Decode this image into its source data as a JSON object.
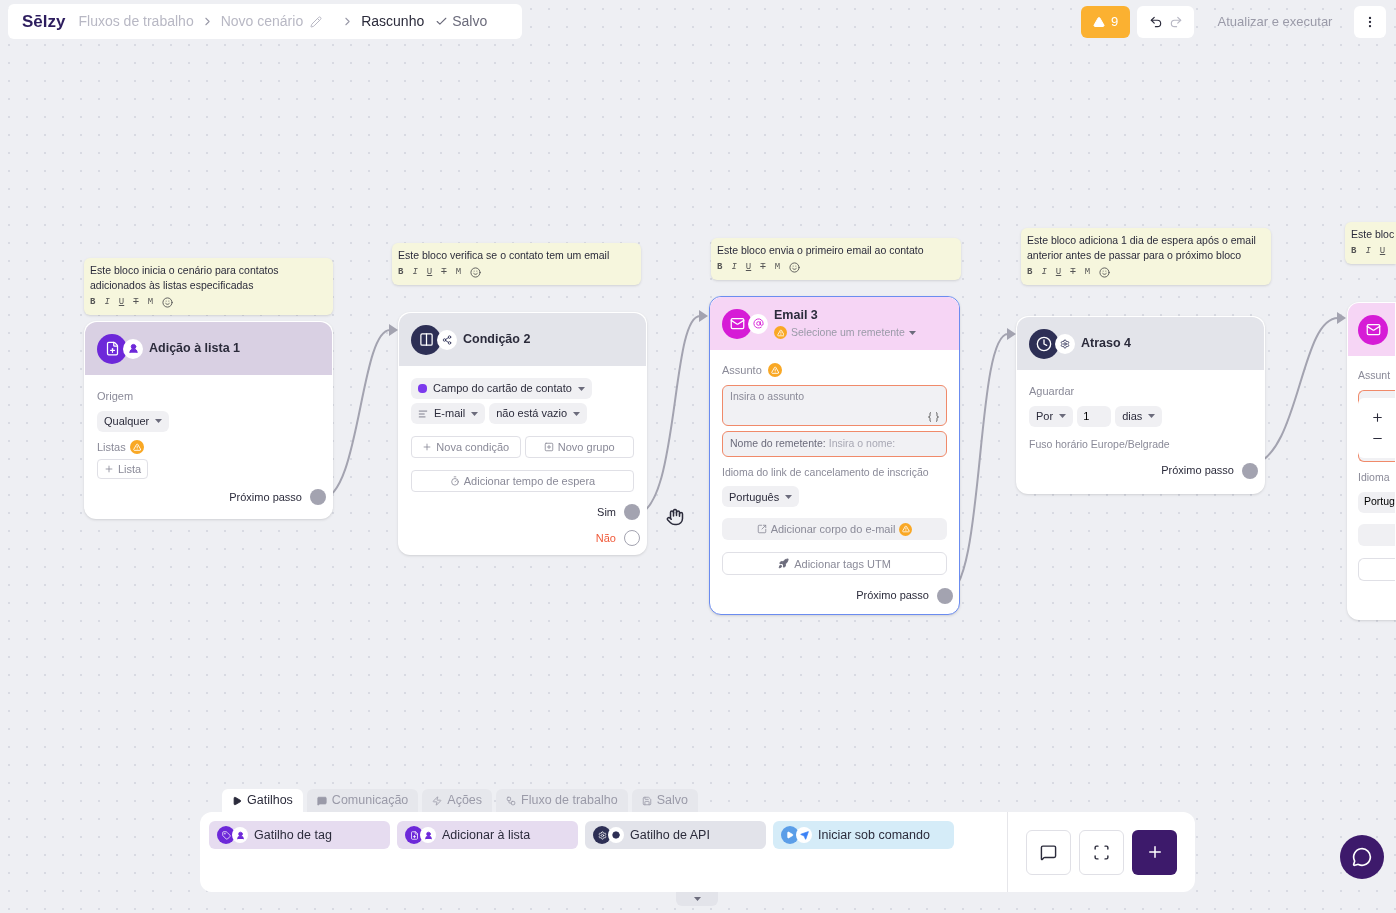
{
  "header": {
    "logo": "Sēlzy",
    "breadcrumbs": [
      "Fluxos de trabalho",
      "Novo cenário"
    ],
    "status": "Rascunho",
    "saved": "Salvo"
  },
  "toolbar": {
    "warnings": "9",
    "run": "Atualizar e executar"
  },
  "notes": [
    {
      "text": "Este bloco inicia o cenário para contatos adicionados às listas especificadas",
      "tools": [
        "B",
        "I",
        "U",
        "T",
        "M"
      ]
    },
    {
      "text": "Este bloco verifica se o contato tem um email",
      "tools": [
        "B",
        "I",
        "U",
        "T",
        "M"
      ]
    },
    {
      "text": "Este bloco envia o primeiro email ao contato",
      "tools": [
        "B",
        "I",
        "U",
        "T",
        "M"
      ]
    },
    {
      "text": "Este bloco adiciona 1 dia de espera após o email anterior antes de passar para o próximo bloco",
      "tools": [
        "B",
        "I",
        "U",
        "T",
        "M"
      ]
    },
    {
      "text": "Este bloc",
      "tools": [
        "B",
        "I",
        "U"
      ]
    }
  ],
  "nodes": [
    {
      "kind": "list_add",
      "title": "Adição à lista 1",
      "selected": false,
      "origin_label": "Origem",
      "origin_value": "Qualquer",
      "lists_label": "Listas",
      "add_list": "Lista",
      "next": "Próximo passo"
    },
    {
      "kind": "condition",
      "title": "Condição 2",
      "selected": false,
      "field": "Campo do cartão de contato",
      "attribute": "E-mail",
      "operator": "não está vazio",
      "actions": [
        "Nova condição",
        "Novo grupo"
      ],
      "wait": "Adicionar tempo de espera",
      "outputs": [
        {
          "label": "Sim",
          "connected": true
        },
        {
          "label": "Não",
          "connected": false
        }
      ]
    },
    {
      "kind": "email",
      "title": "Email 3",
      "selected": true,
      "sender": "Selecione um remetente",
      "subject_label": "Assunto",
      "subject_placeholder": "Insira o assunto",
      "sender_name_label": "Nome do remetente:",
      "sender_name_placeholder": "Insira o nome:",
      "unsub_label": "Idioma do link de cancelamento de inscrição",
      "language": "Português",
      "body_button": "Adicionar corpo do e-mail",
      "utm_button": "Adicionar tags UTM",
      "next": "Próximo passo"
    },
    {
      "kind": "delay",
      "title": "Atraso 4",
      "selected": false,
      "wait_label": "Aguardar",
      "mode": "Por",
      "amount": "1",
      "unit": "dias",
      "timezone": "Fuso horário Europe/Belgrade",
      "next": "Próximo passo"
    },
    {
      "kind": "email_partial",
      "selected": false,
      "subject_label": "Assunt",
      "unsub_label": "Idioma",
      "language": "Portug"
    }
  ],
  "palette": {
    "tabs": [
      {
        "label": "Gatilhos",
        "selected": true
      },
      {
        "label": "Comunicação",
        "selected": false
      },
      {
        "label": "Ações",
        "selected": false
      },
      {
        "label": "Fluxo de trabalho",
        "selected": false
      },
      {
        "label": "Salvo",
        "selected": false
      }
    ],
    "items": [
      {
        "kind": "tag",
        "label": "Gatilho de tag",
        "color": "#e6dcf0"
      },
      {
        "kind": "list",
        "label": "Adicionar à lista",
        "color": "#e6dcf0"
      },
      {
        "kind": "api",
        "label": "Gatilho de API",
        "color": "#e2e3ea"
      },
      {
        "kind": "command",
        "label": "Iniciar sob comando",
        "color": "#d5ecf8"
      }
    ]
  }
}
